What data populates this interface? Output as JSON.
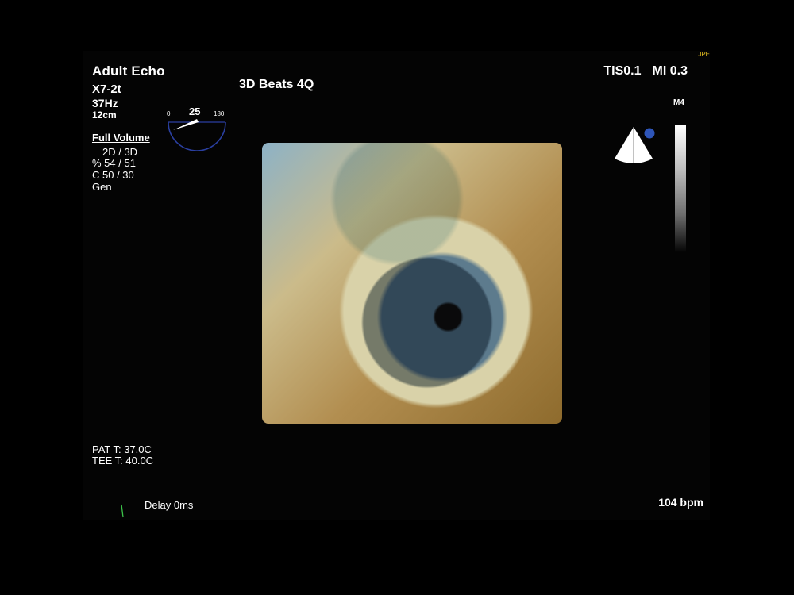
{
  "header": {
    "mode": "Adult Echo",
    "probe": "X7-2t",
    "frame_rate": "37Hz",
    "depth": "12cm",
    "view_label": "3D Beats 4Q",
    "initials": "JPE"
  },
  "safety": {
    "tis": "TIS0.1",
    "mi": "MI 0.3"
  },
  "protractor": {
    "min": "0",
    "max": "180",
    "angle": "25",
    "angle_value": 25
  },
  "acquisition": {
    "title": "Full Volume",
    "row1": "2D / 3D",
    "row2": "% 54 / 51",
    "row3": "C  50 / 30",
    "row4": "Gen"
  },
  "grayscale": {
    "map_label": "M4"
  },
  "temps": {
    "patient": "PAT T: 37.0C",
    "tee": "TEE T: 40.0C"
  },
  "footer": {
    "delay": "Delay 0ms",
    "heart_rate": "104 bpm"
  },
  "colors": {
    "background": "#000000",
    "text": "#ffffff",
    "protractor": "#2a3fa0",
    "orientation_dot": "#2e55b8",
    "ecg_marker": "#3cc24a",
    "initials": "#e8c020"
  }
}
